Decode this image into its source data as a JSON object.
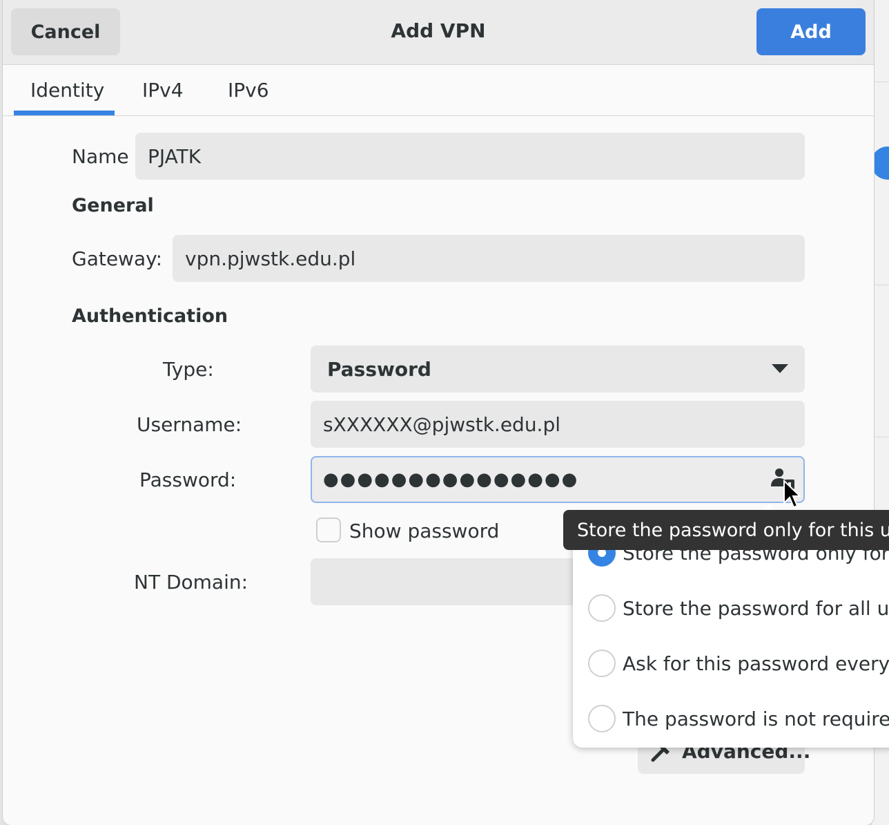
{
  "dialog": {
    "title": "Add VPN",
    "cancel_label": "Cancel",
    "add_label": "Add"
  },
  "tabs": [
    {
      "label": "Identity",
      "active": true
    },
    {
      "label": "IPv4",
      "active": false
    },
    {
      "label": "IPv6",
      "active": false
    }
  ],
  "identity": {
    "name_label": "Name",
    "name_value": "PJATK",
    "general_heading": "General",
    "gateway_label": "Gateway:",
    "gateway_value": "vpn.pjwstk.edu.pl",
    "auth_heading": "Authentication",
    "type_label": "Type:",
    "type_value": "Password",
    "username_label": "Username:",
    "username_value": "sXXXXXX@pjwstk.edu.pl",
    "password_label": "Password:",
    "password_value": "●●●●●●●●●●●●●●●",
    "show_password_label": "Show password",
    "show_password_checked": false,
    "nt_domain_label": "NT Domain:",
    "nt_domain_value": "",
    "advanced_label": "Advanced..."
  },
  "password_popover": {
    "options": [
      {
        "label": "Store the password only for this user",
        "checked": true
      },
      {
        "label": "Store the password for all users",
        "checked": false
      },
      {
        "label": "Ask for this password every time",
        "checked": false
      },
      {
        "label": "The password is not required",
        "checked": false
      }
    ]
  },
  "tooltip": {
    "text": "Store the password only for this user"
  },
  "icons": {
    "password_storage": "user-password-storage-icon",
    "advanced": "wrench-icon",
    "dropdown": "chevron-down-icon"
  },
  "colors": {
    "accent": "#3584e4",
    "suggested_button": "#3b7fde"
  }
}
